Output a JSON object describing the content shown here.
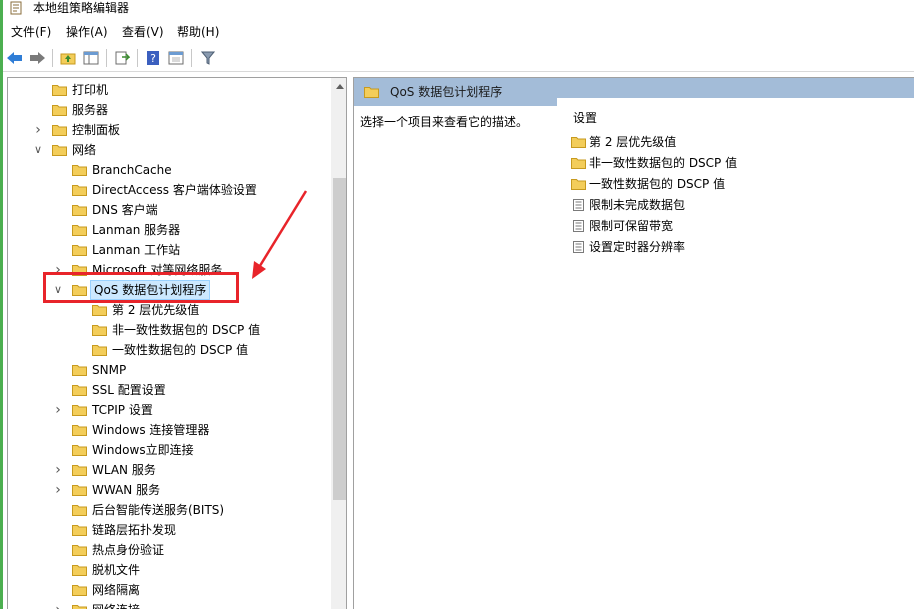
{
  "window": {
    "title": "本地组策略编辑器"
  },
  "menu": {
    "file": "文件(F)",
    "action": "操作(A)",
    "view": "查看(V)",
    "help": "帮助(H)"
  },
  "toolbar": {
    "icons": [
      "back-arrow-icon",
      "forward-arrow-icon",
      "up-folder-icon",
      "show-hide-tree-icon",
      "export-list-icon",
      "help-icon",
      "console-icon",
      "filter-icon"
    ]
  },
  "tree": {
    "items": [
      {
        "label": "打印机",
        "level": 2,
        "expander": "",
        "selected": false
      },
      {
        "label": "服务器",
        "level": 2,
        "expander": "",
        "selected": false
      },
      {
        "label": "控制面板",
        "level": 2,
        "expander": "collapsed",
        "selected": false
      },
      {
        "label": "网络",
        "level": 2,
        "expander": "expanded",
        "selected": false
      },
      {
        "label": "BranchCache",
        "level": 3,
        "expander": "",
        "selected": false
      },
      {
        "label": "DirectAccess 客户端体验设置",
        "level": 3,
        "expander": "",
        "selected": false
      },
      {
        "label": "DNS 客户端",
        "level": 3,
        "expander": "",
        "selected": false
      },
      {
        "label": "Lanman 服务器",
        "level": 3,
        "expander": "",
        "selected": false
      },
      {
        "label": "Lanman 工作站",
        "level": 3,
        "expander": "",
        "selected": false
      },
      {
        "label": "Microsoft 对等网络服务",
        "level": 3,
        "expander": "collapsed",
        "selected": false
      },
      {
        "label": "QoS 数据包计划程序",
        "level": 3,
        "expander": "expanded",
        "selected": true
      },
      {
        "label": "第 2 层优先级值",
        "level": 4,
        "expander": "",
        "selected": false
      },
      {
        "label": "非一致性数据包的 DSCP 值",
        "level": 4,
        "expander": "",
        "selected": false
      },
      {
        "label": "一致性数据包的 DSCP 值",
        "level": 4,
        "expander": "",
        "selected": false
      },
      {
        "label": "SNMP",
        "level": 3,
        "expander": "",
        "selected": false
      },
      {
        "label": "SSL 配置设置",
        "level": 3,
        "expander": "",
        "selected": false
      },
      {
        "label": "TCPIP 设置",
        "level": 3,
        "expander": "collapsed",
        "selected": false
      },
      {
        "label": "Windows 连接管理器",
        "level": 3,
        "expander": "",
        "selected": false
      },
      {
        "label": "Windows立即连接",
        "level": 3,
        "expander": "",
        "selected": false
      },
      {
        "label": "WLAN 服务",
        "level": 3,
        "expander": "collapsed",
        "selected": false
      },
      {
        "label": "WWAN 服务",
        "level": 3,
        "expander": "collapsed",
        "selected": false
      },
      {
        "label": "后台智能传送服务(BITS)",
        "level": 3,
        "expander": "",
        "selected": false
      },
      {
        "label": "链路层拓扑发现",
        "level": 3,
        "expander": "",
        "selected": false
      },
      {
        "label": "热点身份验证",
        "level": 3,
        "expander": "",
        "selected": false
      },
      {
        "label": "脱机文件",
        "level": 3,
        "expander": "",
        "selected": false
      },
      {
        "label": "网络隔离",
        "level": 3,
        "expander": "",
        "selected": false
      },
      {
        "label": "网络连接",
        "level": 3,
        "expander": "collapsed",
        "selected": false
      }
    ]
  },
  "details": {
    "header_title": "QoS 数据包计划程序",
    "description": "选择一个项目来查看它的描述。",
    "column_header": "设置",
    "items": [
      {
        "label": "第 2 层优先级值",
        "kind": "folder"
      },
      {
        "label": "非一致性数据包的 DSCP 值",
        "kind": "folder"
      },
      {
        "label": "一致性数据包的 DSCP 值",
        "kind": "folder"
      },
      {
        "label": "限制未完成数据包",
        "kind": "setting"
      },
      {
        "label": "限制可保留带宽",
        "kind": "setting"
      },
      {
        "label": "设置定时器分辨率",
        "kind": "setting"
      }
    ]
  },
  "colors": {
    "selection_bg": "#cce8ff",
    "header_bg": "#a3bcd8",
    "annotation_red": "#e8242a",
    "folder_yellow": "#f3cd5a"
  }
}
